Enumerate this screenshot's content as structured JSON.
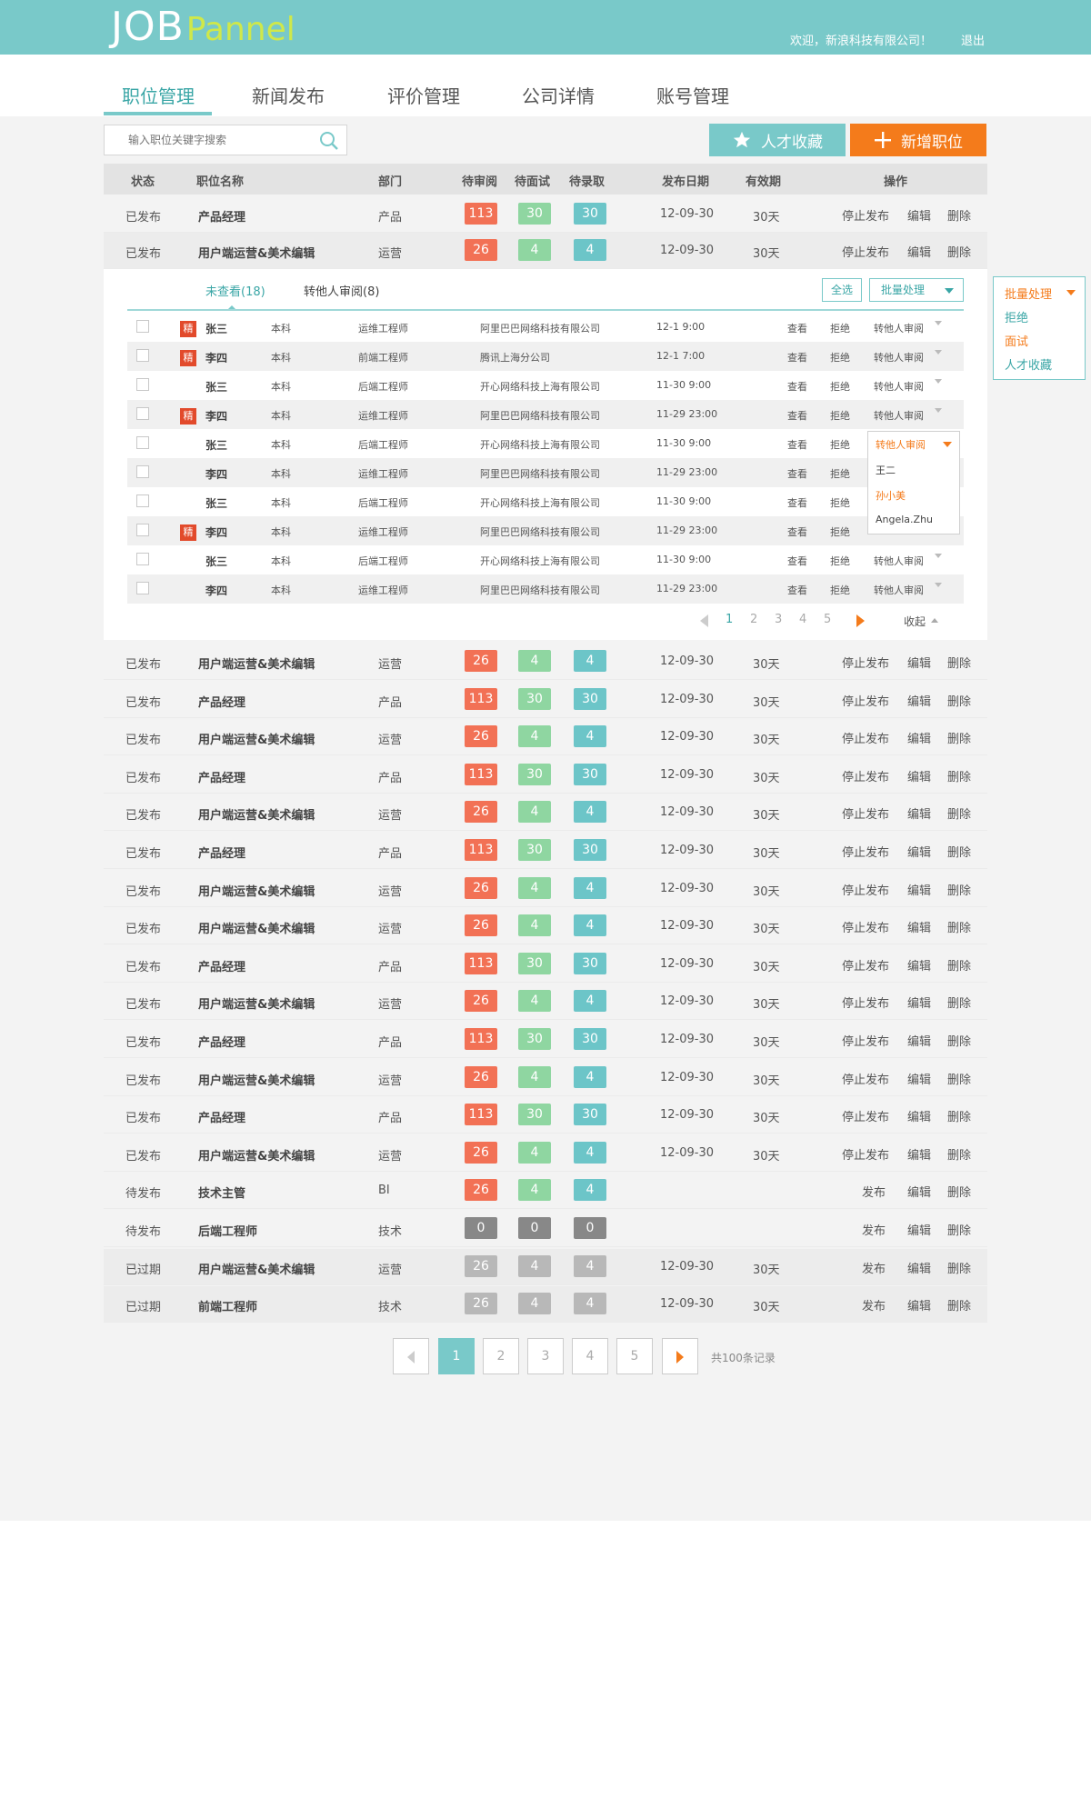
{
  "header": {
    "logo_main": "JOB",
    "logo_sub": "Pannel",
    "welcome": "欢迎，新浪科技有限公司！",
    "logout": "退出"
  },
  "nav": {
    "tabs": [
      "职位管理",
      "新闻发布",
      "评价管理",
      "公司详情",
      "账号管理"
    ],
    "active": 0
  },
  "toolbar": {
    "search_placeholder": "输入职位关键字搜索",
    "collect_label": "人才收藏",
    "add_label": "新增职位"
  },
  "table": {
    "headers": [
      "状态",
      "职位名称",
      "部门",
      "待审阅",
      "待面试",
      "待录取",
      "发布日期",
      "有效期",
      "操作"
    ],
    "top_rows": [
      {
        "status": "已发布",
        "name": "产品经理",
        "dept": "产品",
        "b1": "113",
        "b2": "30",
        "b3": "30",
        "date": "12-09-30",
        "valid": "30天",
        "op1": "停止发布",
        "op2": "编辑",
        "op3": "删除"
      },
      {
        "status": "已发布",
        "name": "用户端运营&美术编辑",
        "dept": "运营",
        "b1": "26",
        "b2": "4",
        "b3": "4",
        "date": "12-09-30",
        "valid": "30天",
        "op1": "停止发布",
        "op2": "编辑",
        "op3": "删除"
      }
    ],
    "rows": [
      {
        "status": "已发布",
        "name": "用户端运营&美术编辑",
        "dept": "运营",
        "b1": "26",
        "b2": "4",
        "b3": "4",
        "date": "12-09-30",
        "valid": "30天",
        "op1": "停止发布",
        "op2": "编辑",
        "op3": "删除"
      },
      {
        "status": "已发布",
        "name": "产品经理",
        "dept": "产品",
        "b1": "113",
        "b2": "30",
        "b3": "30",
        "date": "12-09-30",
        "valid": "30天",
        "op1": "停止发布",
        "op2": "编辑",
        "op3": "删除"
      },
      {
        "status": "已发布",
        "name": "用户端运营&美术编辑",
        "dept": "运营",
        "b1": "26",
        "b2": "4",
        "b3": "4",
        "date": "12-09-30",
        "valid": "30天",
        "op1": "停止发布",
        "op2": "编辑",
        "op3": "删除"
      },
      {
        "status": "已发布",
        "name": "产品经理",
        "dept": "产品",
        "b1": "113",
        "b2": "30",
        "b3": "30",
        "date": "12-09-30",
        "valid": "30天",
        "op1": "停止发布",
        "op2": "编辑",
        "op3": "删除"
      },
      {
        "status": "已发布",
        "name": "用户端运营&美术编辑",
        "dept": "运营",
        "b1": "26",
        "b2": "4",
        "b3": "4",
        "date": "12-09-30",
        "valid": "30天",
        "op1": "停止发布",
        "op2": "编辑",
        "op3": "删除"
      },
      {
        "status": "已发布",
        "name": "产品经理",
        "dept": "产品",
        "b1": "113",
        "b2": "30",
        "b3": "30",
        "date": "12-09-30",
        "valid": "30天",
        "op1": "停止发布",
        "op2": "编辑",
        "op3": "删除"
      },
      {
        "status": "已发布",
        "name": "用户端运营&美术编辑",
        "dept": "运营",
        "b1": "26",
        "b2": "4",
        "b3": "4",
        "date": "12-09-30",
        "valid": "30天",
        "op1": "停止发布",
        "op2": "编辑",
        "op3": "删除"
      },
      {
        "status": "已发布",
        "name": "用户端运营&美术编辑",
        "dept": "运营",
        "b1": "26",
        "b2": "4",
        "b3": "4",
        "date": "12-09-30",
        "valid": "30天",
        "op1": "停止发布",
        "op2": "编辑",
        "op3": "删除"
      },
      {
        "status": "已发布",
        "name": "产品经理",
        "dept": "产品",
        "b1": "113",
        "b2": "30",
        "b3": "30",
        "date": "12-09-30",
        "valid": "30天",
        "op1": "停止发布",
        "op2": "编辑",
        "op3": "删除"
      },
      {
        "status": "已发布",
        "name": "用户端运营&美术编辑",
        "dept": "运营",
        "b1": "26",
        "b2": "4",
        "b3": "4",
        "date": "12-09-30",
        "valid": "30天",
        "op1": "停止发布",
        "op2": "编辑",
        "op3": "删除"
      },
      {
        "status": "已发布",
        "name": "产品经理",
        "dept": "产品",
        "b1": "113",
        "b2": "30",
        "b3": "30",
        "date": "12-09-30",
        "valid": "30天",
        "op1": "停止发布",
        "op2": "编辑",
        "op3": "删除"
      },
      {
        "status": "已发布",
        "name": "用户端运营&美术编辑",
        "dept": "运营",
        "b1": "26",
        "b2": "4",
        "b3": "4",
        "date": "12-09-30",
        "valid": "30天",
        "op1": "停止发布",
        "op2": "编辑",
        "op3": "删除"
      },
      {
        "status": "已发布",
        "name": "产品经理",
        "dept": "产品",
        "b1": "113",
        "b2": "30",
        "b3": "30",
        "date": "12-09-30",
        "valid": "30天",
        "op1": "停止发布",
        "op2": "编辑",
        "op3": "删除"
      },
      {
        "status": "已发布",
        "name": "用户端运营&美术编辑",
        "dept": "运营",
        "b1": "26",
        "b2": "4",
        "b3": "4",
        "date": "12-09-30",
        "valid": "30天",
        "op1": "停止发布",
        "op2": "编辑",
        "op3": "删除"
      },
      {
        "status": "待发布",
        "name": "技术主管",
        "dept": "BI",
        "b1": "26",
        "b2": "4",
        "b3": "4",
        "date": "",
        "valid": "",
        "op1": "发布",
        "op2": "编辑",
        "op3": "删除"
      },
      {
        "status": "待发布",
        "name": "后端工程师",
        "dept": "技术",
        "b1": "0",
        "b2": "0",
        "b3": "0",
        "date": "",
        "valid": "",
        "op1": "发布",
        "op2": "编辑",
        "op3": "删除"
      },
      {
        "status": "已过期",
        "name": "用户端运营&美术编辑",
        "dept": "运营",
        "b1": "26",
        "b2": "4",
        "b3": "4",
        "date": "12-09-30",
        "valid": "30天",
        "op1": "发布",
        "op2": "编辑",
        "op3": "删除"
      },
      {
        "status": "已过期",
        "name": "前端工程师",
        "dept": "技术",
        "b1": "26",
        "b2": "4",
        "b3": "4",
        "date": "12-09-30",
        "valid": "30天",
        "op1": "发布",
        "op2": "编辑",
        "op3": "删除"
      }
    ]
  },
  "candidates": {
    "tab_unread": "未查看(18)",
    "tab_transfer": "转他人审阅(8)",
    "select_all": "全选",
    "batch": "批量处理",
    "rows": [
      {
        "tag": "精",
        "name": "张三",
        "edu": "本科",
        "pos": "运维工程师",
        "company": "阿里巴巴网络科技有限公司",
        "date": "12-1   9:00",
        "view": "查看",
        "reject": "拒绝",
        "transfer": "转他人审阅"
      },
      {
        "tag": "精",
        "name": "李四",
        "edu": "本科",
        "pos": "前端工程师",
        "company": "腾讯上海分公司",
        "date": "12-1   7:00",
        "view": "查看",
        "reject": "拒绝",
        "transfer": "转他人审阅"
      },
      {
        "tag": "",
        "name": "张三",
        "edu": "本科",
        "pos": "后端工程师",
        "company": "开心网络科技上海有限公司",
        "date": "11-30  9:00",
        "view": "查看",
        "reject": "拒绝",
        "transfer": "转他人审阅"
      },
      {
        "tag": "精",
        "name": "李四",
        "edu": "本科",
        "pos": "运维工程师",
        "company": "阿里巴巴网络科技有限公司",
        "date": "11-29  23:00",
        "view": "查看",
        "reject": "拒绝",
        "transfer": "转他人审阅"
      },
      {
        "tag": "",
        "name": "张三",
        "edu": "本科",
        "pos": "后端工程师",
        "company": "开心网络科技上海有限公司",
        "date": "11-30  9:00",
        "view": "查看",
        "reject": "拒绝",
        "transfer": ""
      },
      {
        "tag": "",
        "name": "李四",
        "edu": "本科",
        "pos": "运维工程师",
        "company": "阿里巴巴网络科技有限公司",
        "date": "11-29  23:00",
        "view": "查看",
        "reject": "拒绝",
        "transfer": ""
      },
      {
        "tag": "",
        "name": "张三",
        "edu": "本科",
        "pos": "后端工程师",
        "company": "开心网络科技上海有限公司",
        "date": "11-30  9:00",
        "view": "查看",
        "reject": "拒绝",
        "transfer": ""
      },
      {
        "tag": "精",
        "name": "李四",
        "edu": "本科",
        "pos": "运维工程师",
        "company": "阿里巴巴网络科技有限公司",
        "date": "11-29  23:00",
        "view": "查看",
        "reject": "拒绝",
        "transfer": ""
      },
      {
        "tag": "",
        "name": "张三",
        "edu": "本科",
        "pos": "后端工程师",
        "company": "开心网络科技上海有限公司",
        "date": "11-30  9:00",
        "view": "查看",
        "reject": "拒绝",
        "transfer": "转他人审阅"
      },
      {
        "tag": "",
        "name": "李四",
        "edu": "本科",
        "pos": "运维工程师",
        "company": "阿里巴巴网络科技有限公司",
        "date": "11-29  23:00",
        "view": "查看",
        "reject": "拒绝",
        "transfer": "转他人审阅"
      }
    ],
    "dropdown": {
      "head": "转他人审阅",
      "items": [
        "王二",
        "孙小美",
        "Angela.Zhu"
      ]
    },
    "pager": [
      "1",
      "2",
      "3",
      "4",
      "5"
    ],
    "collapse": "收起"
  },
  "side_panel": {
    "head": "批量处理",
    "items": [
      "拒绝",
      "面试",
      "人才收藏"
    ]
  },
  "pagination": {
    "pages": [
      "1",
      "2",
      "3",
      "4",
      "5"
    ],
    "active": "1",
    "total": "共100条记录"
  },
  "colors": {
    "brand": "#79c9c9",
    "accent": "#f47b1b",
    "badge_red": "#f27155",
    "badge_green": "#8fd6a1",
    "badge_teal": "#6cc5c8"
  }
}
